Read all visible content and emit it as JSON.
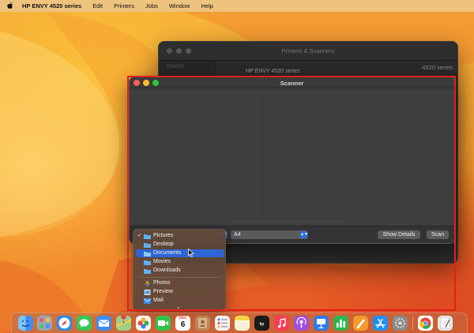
{
  "menubar": {
    "app_name": "HP ENVY 4520 series",
    "items": [
      "Edit",
      "Printers",
      "Jobs",
      "Window",
      "Help"
    ]
  },
  "background_window": {
    "title": "Printers & Scanners",
    "search_placeholder": "Search",
    "printer_name": "HP ENVY 4520 series",
    "right_label": "4520 series",
    "help_label": "?"
  },
  "scanner_window": {
    "title": "Scanner",
    "paper_size": "A4",
    "show_details_label": "Show Details",
    "scan_label": "Scan"
  },
  "location_menu": {
    "items": [
      {
        "label": "Pictures",
        "icon": "folder-icon",
        "checked": true,
        "selected": false
      },
      {
        "label": "Desktop",
        "icon": "folder-icon",
        "checked": false,
        "selected": false
      },
      {
        "label": "Documents",
        "icon": "folder-icon",
        "checked": false,
        "selected": true
      },
      {
        "label": "Movies",
        "icon": "folder-icon",
        "checked": false,
        "selected": false
      },
      {
        "label": "Downloads",
        "icon": "folder-icon",
        "checked": false,
        "selected": false
      }
    ],
    "apps": [
      {
        "label": "Photos",
        "icon": "photos-icon"
      },
      {
        "label": "Preview",
        "icon": "preview-icon"
      },
      {
        "label": "Mail",
        "icon": "mail-icon"
      }
    ],
    "more_symbol": "⌄",
    "check_symbol": "✓"
  },
  "dock": {
    "calendar_month": "DEC",
    "calendar_day": "6",
    "apps": [
      {
        "name": "finder",
        "color": "#3f8ef0"
      },
      {
        "name": "launchpad",
        "color": "#9aa7b8"
      },
      {
        "name": "safari",
        "color": "#2f8be8"
      },
      {
        "name": "messages",
        "color": "#35c759"
      },
      {
        "name": "mail",
        "color": "#3a8ef3"
      },
      {
        "name": "maps",
        "color": "#5fb36a"
      },
      {
        "name": "photos",
        "color": "#f5f5f5"
      },
      {
        "name": "facetime",
        "color": "#33c24d"
      },
      {
        "name": "calendar",
        "color": "#ffffff"
      },
      {
        "name": "contacts",
        "color": "#b8875a"
      },
      {
        "name": "reminders",
        "color": "#f2f2f2"
      },
      {
        "name": "notes",
        "color": "#f6d44a"
      },
      {
        "name": "tv",
        "color": "#1b1b1b"
      },
      {
        "name": "music",
        "color": "#f43f53"
      },
      {
        "name": "podcasts",
        "color": "#a04ee0"
      },
      {
        "name": "keynote",
        "color": "#2d7bf0"
      },
      {
        "name": "numbers",
        "color": "#2fb452"
      },
      {
        "name": "pages",
        "color": "#f59a2b"
      },
      {
        "name": "app-store",
        "color": "#1e8ef5"
      },
      {
        "name": "system-settings",
        "color": "#8a8a8a"
      },
      {
        "name": "chrome",
        "color": "#ffffff"
      },
      {
        "name": "textedit",
        "color": "#e9e9e9"
      }
    ]
  }
}
